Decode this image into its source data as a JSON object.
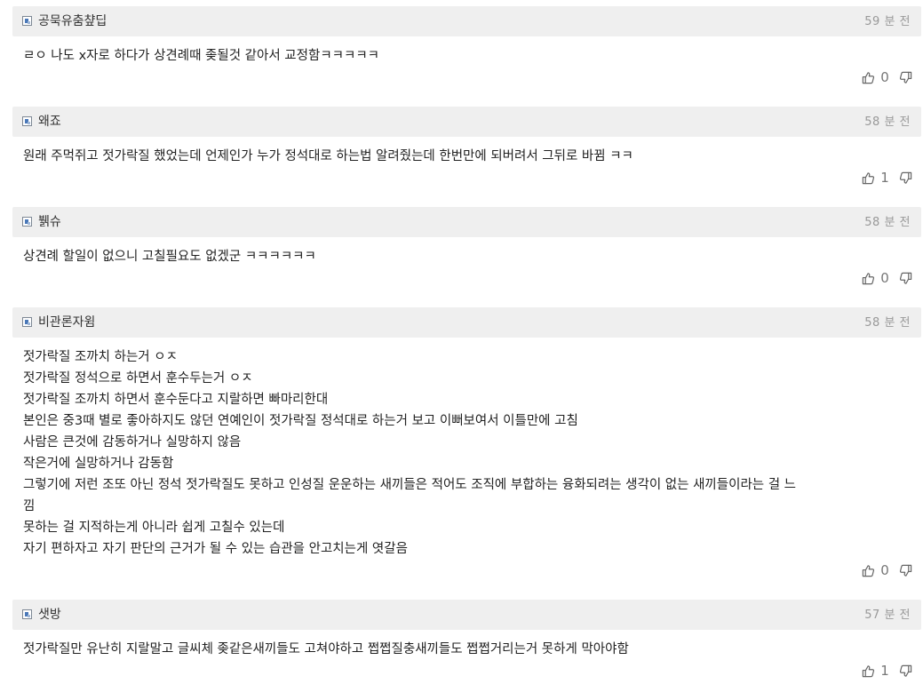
{
  "comments": [
    {
      "author": "공묵유춤챺딥",
      "time": "59 분 전",
      "lines": [
        "ㄹㅇ 나도 x자로 하다가 상견례때 좆될것 같아서 교정함ㅋㅋㅋㅋㅋ"
      ],
      "upvotes": "0"
    },
    {
      "author": "왜죠",
      "time": "58 분 전",
      "lines": [
        "원래 주먹쥐고 젓가락질 했었는데 언제인가 누가 정석대로 하는법 알려줬는데 한번만에 되버려서 그뒤로 바뀜 ㅋㅋ"
      ],
      "upvotes": "1"
    },
    {
      "author": "뷁슈",
      "time": "58 분 전",
      "lines": [
        "상견례 할일이 없으니 고칠필요도 없겠군 ㅋㅋㅋㅋㅋㅋ"
      ],
      "upvotes": "0"
    },
    {
      "author": "비관론자윔",
      "time": "58 분 전",
      "lines": [
        "젓가락질 조까치 하는거 ㅇㅈ",
        "젓가락질 정석으로 하면서 훈수두는거 ㅇㅈ",
        "젓가락질 조까치 하면서 훈수둔다고 지랄하면 빠마리한대",
        "본인은 중3때 별로 좋아하지도 않던 연예인이 젓가락질 정석대로 하는거 보고 이뻐보여서 이틀만에 고침",
        "사람은 큰것에 감동하거나 실망하지 않음",
        "작은거에 실망하거나 감동함",
        "그렇기에 저런 조또 아닌 정석 젓가락질도 못하고 인성질 운운하는 새끼들은 적어도 조직에 부합하는 융화되려는 생각이 없는 새끼들이라는 걸 느",
        "낌",
        "못하는 걸 지적하는게 아니라 쉽게 고칠수 있는데",
        "자기 편하자고 자기 판단의 근거가 될 수 있는 습관을 안고치는게 엿갈음"
      ],
      "upvotes": "0"
    },
    {
      "author": "샛방",
      "time": "57 분 전",
      "lines": [
        "젓가락질만 유난히 지랄말고 글씨체 좆같은새끼들도 고쳐야하고 쩝쩝질충새끼들도 쩝쩝거리는거 못하게 막아야함"
      ],
      "upvotes": "1"
    }
  ],
  "icons": {
    "author": "user-profile-icon",
    "upvote": "thumbs-up-icon",
    "downvote": "thumbs-down-icon"
  }
}
